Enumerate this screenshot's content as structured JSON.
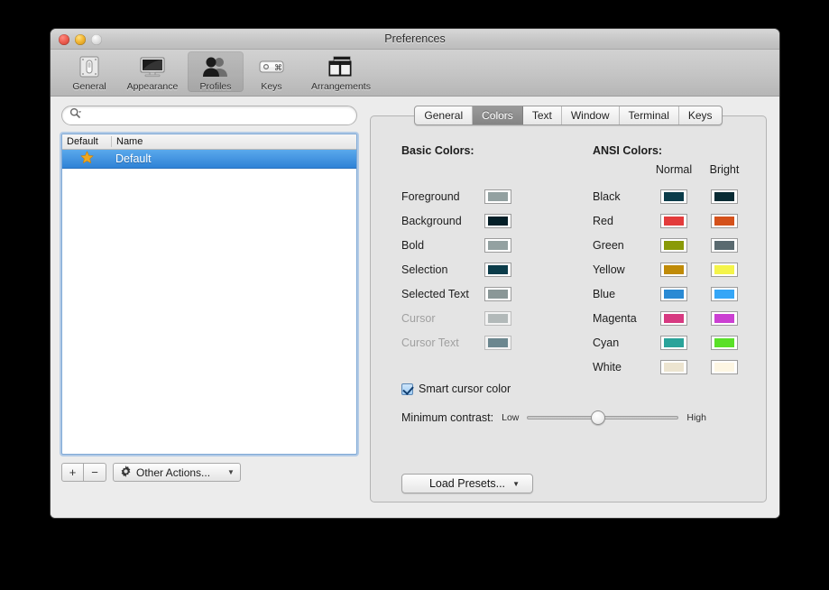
{
  "window": {
    "title": "Preferences",
    "traffic_lights": [
      "close-button",
      "minimize-button",
      "zoom-button"
    ]
  },
  "toolbar": {
    "items": [
      {
        "label": "General",
        "icon": "general-switch-icon"
      },
      {
        "label": "Appearance",
        "icon": "display-monitor-icon"
      },
      {
        "label": "Profiles",
        "icon": "profiles-people-icon"
      },
      {
        "label": "Keys",
        "icon": "keyboard-key-icon"
      },
      {
        "label": "Arrangements",
        "icon": "window-arrangements-icon"
      }
    ],
    "selected": "Profiles"
  },
  "sidebar": {
    "search": {
      "value": "",
      "placeholder": "",
      "icon": "search-magnifier-icon"
    },
    "columns": [
      "Default",
      "Name"
    ],
    "rows": [
      {
        "name": "Default",
        "is_default": true,
        "star": "★",
        "selected": true
      }
    ],
    "footer": {
      "add_label": "+",
      "remove_label": "−",
      "other_actions_label": "Other Actions...",
      "gear_icon": "gear-icon",
      "caret": "▼"
    }
  },
  "tabs": {
    "items": [
      "General",
      "Colors",
      "Text",
      "Window",
      "Terminal",
      "Keys"
    ],
    "active": "Colors"
  },
  "colors_panel": {
    "basic_title": "Basic Colors:",
    "ansi_title": "ANSI Colors:",
    "ansi_columns": [
      "Normal",
      "Bright"
    ],
    "basic_colors": [
      {
        "label": "Foreground",
        "color": "#93a1a1",
        "disabled": false
      },
      {
        "label": "Background",
        "color": "#041f28",
        "disabled": false
      },
      {
        "label": "Bold",
        "color": "#93a1a1",
        "disabled": false
      },
      {
        "label": "Selection",
        "color": "#0b3c4a",
        "disabled": false
      },
      {
        "label": "Selected Text",
        "color": "#8a9797",
        "disabled": false
      },
      {
        "label": "Cursor",
        "color": "#8a9797",
        "disabled": true
      },
      {
        "label": "Cursor Text",
        "color": "#0b3c4a",
        "disabled": true
      }
    ],
    "ansi_colors": [
      {
        "label": "Black",
        "normal": "#0b3c4a",
        "bright": "#082b34"
      },
      {
        "label": "Red",
        "normal": "#e33b3b",
        "bright": "#d4511b"
      },
      {
        "label": "Green",
        "normal": "#8a9a08",
        "bright": "#5a6a70"
      },
      {
        "label": "Yellow",
        "normal": "#c08b07",
        "bright": "#f4f44a"
      },
      {
        "label": "Blue",
        "normal": "#2a8ad4",
        "bright": "#35a6f7"
      },
      {
        "label": "Magenta",
        "normal": "#d73a81",
        "bright": "#cb40d2"
      },
      {
        "label": "Cyan",
        "normal": "#2aa39a",
        "bright": "#5ae028"
      },
      {
        "label": "White",
        "normal": "#ece4d0",
        "bright": "#fdf6e3"
      }
    ],
    "smart_cursor": {
      "label": "Smart cursor color",
      "checked": true
    },
    "minimum_contrast": {
      "label": "Minimum contrast:",
      "low_label": "Low",
      "high_label": "High",
      "value_percent": 47
    },
    "load_presets": {
      "label": "Load Presets...",
      "caret": "▼"
    }
  }
}
